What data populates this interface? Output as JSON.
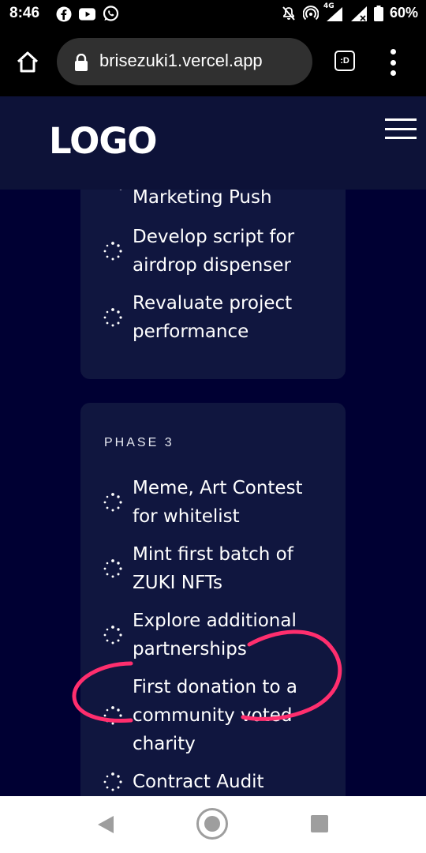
{
  "status_bar": {
    "time": "8:46",
    "network": "4G",
    "battery": "60%"
  },
  "browser": {
    "url": "brisezuki1.vercel.app",
    "tabs_icon_label": ":D"
  },
  "header": {
    "logo": "LOGO"
  },
  "cards": [
    {
      "items": [
        {
          "line1": "Marketing Push",
          "line2": ""
        },
        {
          "line1": "Develop script for",
          "line2": "airdrop dispenser"
        },
        {
          "line1": "Revaluate project",
          "line2": "performance"
        }
      ]
    },
    {
      "phase": "PHASE 3",
      "items": [
        {
          "line1": "Meme, Art Contest",
          "line2": "for whitelist"
        },
        {
          "line1": "Mint first batch of",
          "line2": "ZUKI NFTs"
        },
        {
          "line1": "Explore additional",
          "line2": "partnerships"
        },
        {
          "line1": "First donation to a",
          "line2": "community voted",
          "line3": "charity"
        },
        {
          "line1": "Contract Audit",
          "line2": ""
        }
      ]
    }
  ],
  "colors": {
    "page_bg": "#000033",
    "header_bg": "#0d1238",
    "card_bg": "#10163f",
    "annotation": "#ff2e6e"
  }
}
